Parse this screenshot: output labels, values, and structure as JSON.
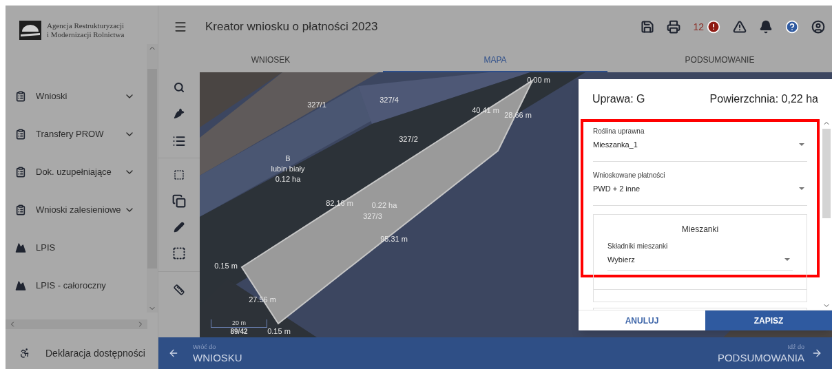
{
  "sidebar": {
    "logo_lines": [
      "Agencja Restrukturyzacji",
      "i Modernizacji Rolnictwa"
    ],
    "items": [
      {
        "label": "Wnioski",
        "kind": "clipboard",
        "expandable": true
      },
      {
        "label": "Transfery PROW",
        "kind": "clipboard",
        "expandable": true
      },
      {
        "label": "Dok. uzupełniające",
        "kind": "clipboard",
        "expandable": true
      },
      {
        "label": "Wnioski zalesieniowe",
        "kind": "clipboard",
        "expandable": true
      },
      {
        "label": "LPIS",
        "kind": "mountain",
        "expandable": false
      },
      {
        "label": "LPIS - całoroczny",
        "kind": "mountain",
        "expandable": false
      }
    ],
    "footer_item": {
      "label": "Deklaracja dostępności"
    }
  },
  "header": {
    "title": "Kreator wniosku o płatności 2023",
    "error_count": "12"
  },
  "tabs": [
    {
      "label": "WNIOSEK",
      "selected": false
    },
    {
      "label": "MAPA",
      "selected": true
    },
    {
      "label": "PODSUMOWANIE",
      "selected": false
    }
  ],
  "map": {
    "labels": [
      {
        "text": "0.00 m"
      },
      {
        "text": "327/4"
      },
      {
        "text": "327/1"
      },
      {
        "text": "40.41 m"
      },
      {
        "text": "28.66 m"
      },
      {
        "text": "327/2"
      },
      {
        "text": "B"
      },
      {
        "text": "lubin biały"
      },
      {
        "text": "0.12 ha"
      },
      {
        "text": "82.16 m"
      },
      {
        "text": "0.22 ha"
      },
      {
        "text": "327/3"
      },
      {
        "text": "95.31 m"
      },
      {
        "text": "0.15 m"
      },
      {
        "text": "27.56 m"
      },
      {
        "text": "0.15 m"
      }
    ],
    "scale": {
      "distance": "20 m",
      "sheet": "89/42"
    }
  },
  "dialog": {
    "crop": "Uprawa: G",
    "area": "Powierzchnia: 0,22 ha",
    "fields": [
      {
        "label": "Roślina uprawna",
        "value": "Mieszanka_1"
      },
      {
        "label": "Wnioskowane płatności",
        "value": "PWD + 2 inne"
      }
    ],
    "mix_section": {
      "title": "Mieszanki",
      "field": {
        "label": "Składniki mieszanki",
        "value": "Wybierz"
      }
    },
    "buttons": [
      {
        "label": "ANULUJ",
        "kind": "secondary"
      },
      {
        "label": "ZAPISZ",
        "kind": "primary"
      }
    ]
  },
  "footer_nav": {
    "back": {
      "caption": "Wróć do",
      "target": "WNIOSKU"
    },
    "next": {
      "caption": "Idź do",
      "target": "PODSUMOWANIA"
    }
  }
}
